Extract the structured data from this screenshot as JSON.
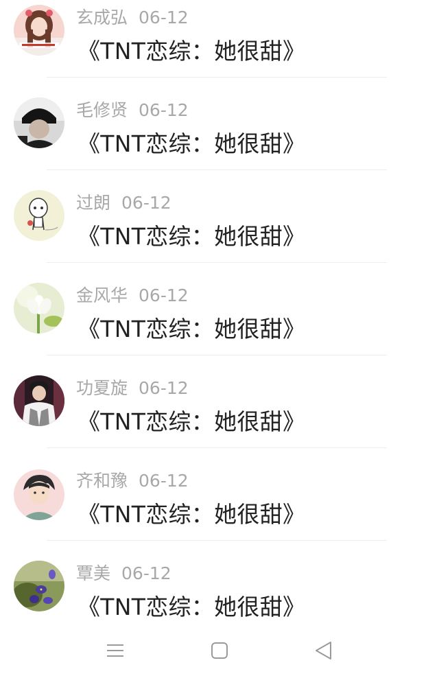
{
  "comments": [
    {
      "name": "玄成弘",
      "date": "06-12",
      "text": "《TNT恋综：她很甜》",
      "avatar_icon": "girl-photo-avatar-icon"
    },
    {
      "name": "毛修贤",
      "date": "06-12",
      "text": "《TNT恋综：她很甜》",
      "avatar_icon": "boy-black-cap-avatar-icon"
    },
    {
      "name": "过朗",
      "date": "06-12",
      "text": "《TNT恋综：她很甜》",
      "avatar_icon": "cartoon-character-avatar-icon"
    },
    {
      "name": "金风华",
      "date": "06-12",
      "text": "《TNT恋综：她很甜》",
      "avatar_icon": "lotus-flower-avatar-icon"
    },
    {
      "name": "功夏旋",
      "date": "06-12",
      "text": "《TNT恋综：她很甜》",
      "avatar_icon": "boy-vest-avatar-icon"
    },
    {
      "name": "齐和豫",
      "date": "06-12",
      "text": "《TNT恋综：她很甜》",
      "avatar_icon": "anime-boy-avatar-icon"
    },
    {
      "name": "覃美",
      "date": "06-12",
      "text": "《TNT恋综：她很甜》",
      "avatar_icon": "purple-flower-avatar-icon"
    }
  ],
  "navbar": {
    "menu_icon": "menu-icon",
    "home_icon": "home-square-icon",
    "back_icon": "back-triangle-icon",
    "icon_color": "#9a9a9a"
  },
  "colors": {
    "name_color": "#a8a8a8",
    "text_color": "#222222",
    "divider_color": "#ededed"
  }
}
